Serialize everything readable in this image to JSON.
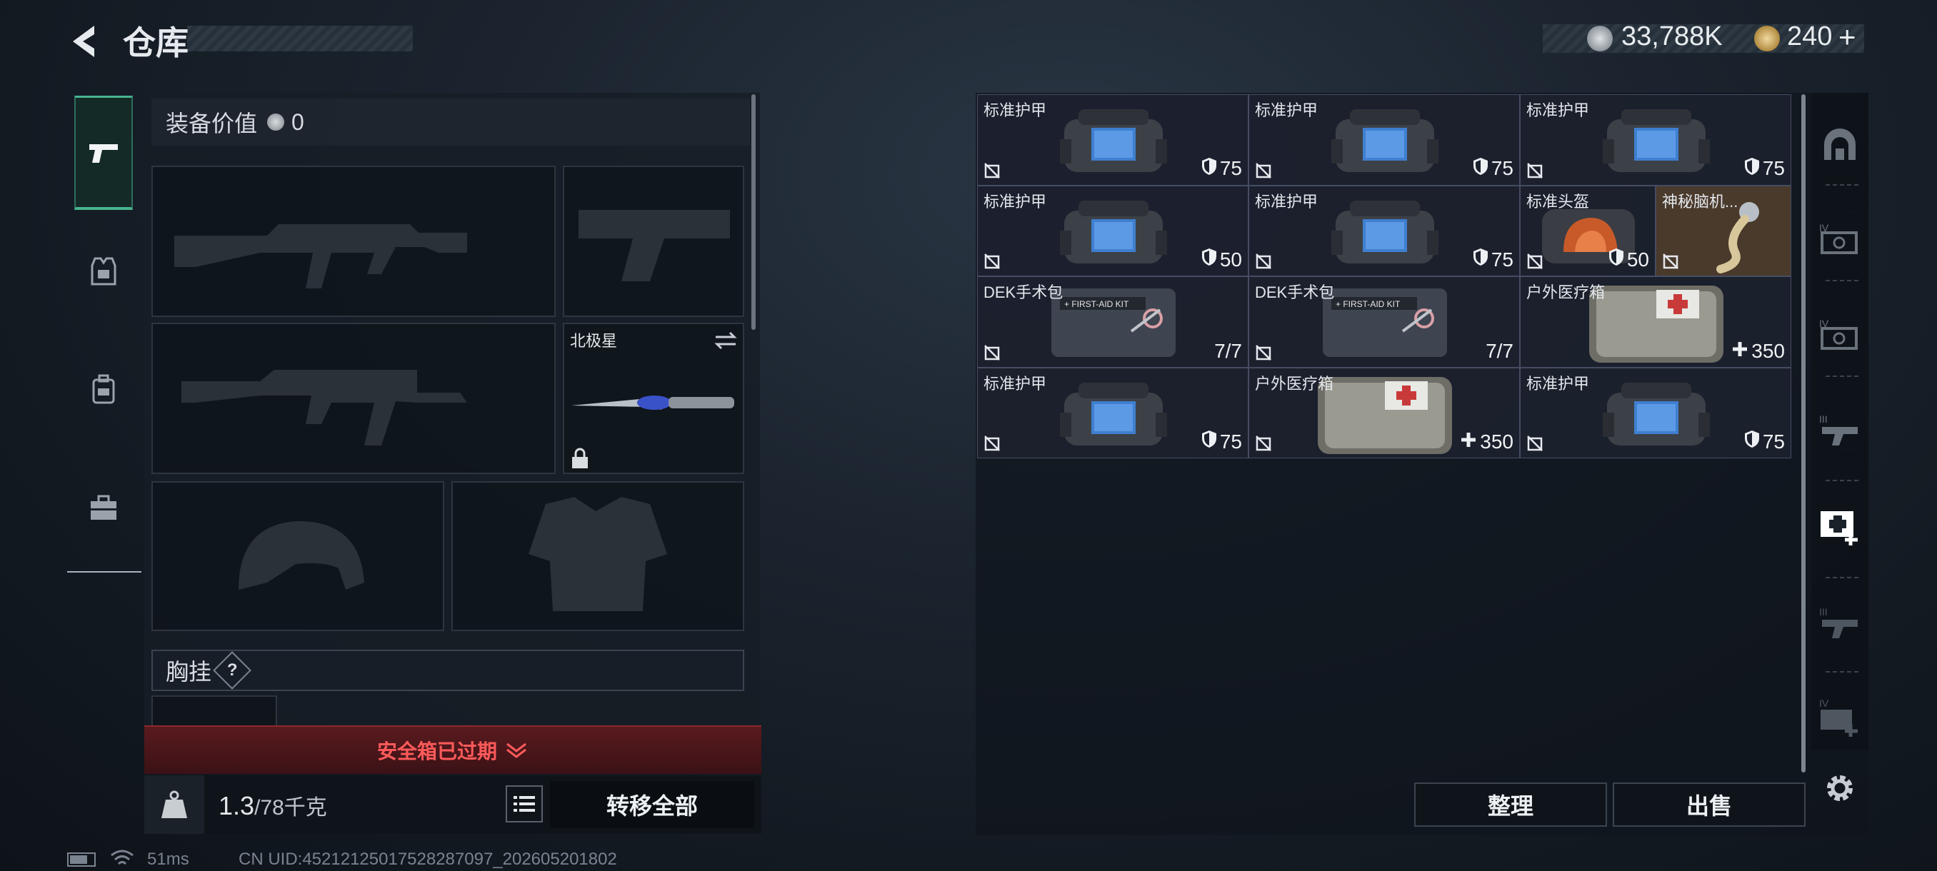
{
  "header": {
    "title": "仓库"
  },
  "currency": {
    "silver_value": "33,788K",
    "gold_value": "240",
    "add_symbol": "+"
  },
  "equipment": {
    "value_label": "装备价值",
    "value": "0",
    "melee_name": "北极星",
    "chest_rig_label": "胸挂",
    "help_symbol": "?",
    "safe_box_status": "安全箱已过期",
    "weight_current": "1.3",
    "weight_max": "/78千克",
    "transfer_all_label": "转移全部"
  },
  "storage": {
    "items": [
      {
        "name": "标准护甲",
        "type": "armor",
        "value": "75",
        "value_icon": "shield-icon"
      },
      {
        "name": "标准护甲",
        "type": "armor",
        "value": "75",
        "value_icon": "shield-icon"
      },
      {
        "name": "标准护甲",
        "type": "armor",
        "value": "75",
        "value_icon": "shield-icon"
      },
      {
        "name": "标准护甲",
        "type": "armor",
        "value": "50",
        "value_icon": "shield-icon"
      },
      {
        "name": "标准护甲",
        "type": "armor",
        "value": "75",
        "value_icon": "shield-icon"
      },
      {
        "name": "标准头盔",
        "type": "helmet",
        "value": "50",
        "value_icon": "shield-icon"
      },
      {
        "name": "神秘脑机...",
        "type": "mystery",
        "value": "",
        "value_icon": ""
      },
      {
        "name": "DEK手术包",
        "type": "surgery",
        "value": "7/7",
        "value_icon": ""
      },
      {
        "name": "DEK手术包",
        "type": "surgery",
        "value": "7/7",
        "value_icon": ""
      },
      {
        "name": "户外医疗箱",
        "type": "medkit",
        "value": "350",
        "value_icon": "plus-icon"
      },
      {
        "name": "标准护甲",
        "type": "armor",
        "value": "75",
        "value_icon": "shield-icon"
      },
      {
        "name": "户外医疗箱",
        "type": "medkit",
        "value": "350",
        "value_icon": "plus-icon"
      },
      {
        "name": "标准护甲",
        "type": "armor",
        "value": "75",
        "value_icon": "shield-icon"
      }
    ],
    "arrange_label": "整理",
    "sell_label": "出售"
  },
  "status": {
    "ping": "51ms",
    "uid": "CN UID:45212125017528287097_202605201802"
  },
  "colors": {
    "accent_green": "#48b48e",
    "warning_red": "#ff5a5a",
    "cell_bg": "#1c212e"
  }
}
